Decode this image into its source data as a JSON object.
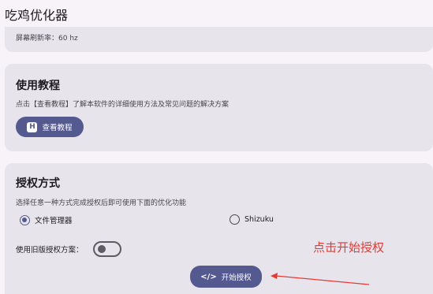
{
  "app": {
    "title": "吃鸡优化器"
  },
  "display": {
    "refresh_label": "屏幕刷新率：60 hz"
  },
  "tutorial": {
    "title": "使用教程",
    "description": "点击【查看教程】了解本软件的详细使用方法及常见问题的解决方案",
    "button_icon": "H",
    "button_label": "查看教程"
  },
  "auth": {
    "title": "授权方式",
    "description": "选择任意一种方式完成授权后即可使用下面的优化功能",
    "options": [
      {
        "label": "文件管理器",
        "selected": true
      },
      {
        "label": "Shizuku",
        "selected": false
      }
    ],
    "legacy_label": "使用旧版授权方案：",
    "legacy_enabled": false,
    "start_label": "开始授权"
  },
  "annotation": {
    "text": "点击开始授权",
    "color": "#e53935"
  },
  "colors": {
    "accent": "#545a8f",
    "card": "#e8e4ec",
    "background": "#f7f3f8"
  }
}
